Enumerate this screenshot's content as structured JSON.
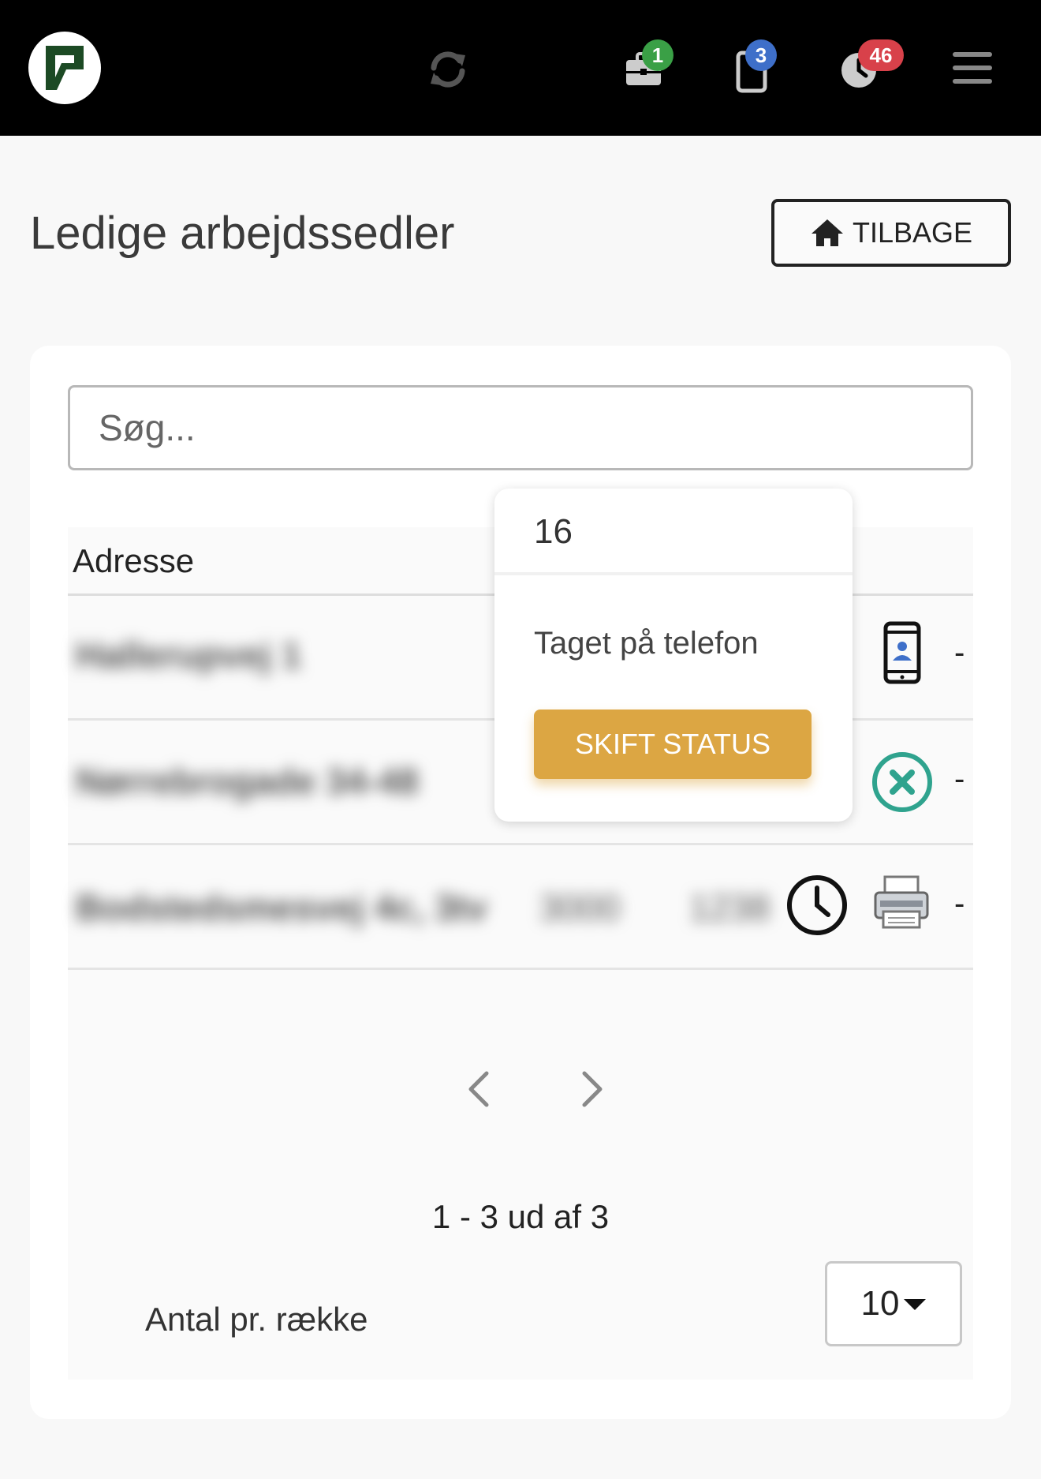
{
  "navbar": {
    "badges": {
      "briefcase": "1",
      "phone": "3",
      "clock": "46"
    },
    "colors": {
      "green": "#3aa046",
      "blue": "#3e6fc9",
      "red": "#d8414a"
    }
  },
  "header": {
    "title": "Ledige arbejdssedler",
    "back_label": "TILBAGE"
  },
  "search": {
    "placeholder": "Søg..."
  },
  "table": {
    "column_header": "Adresse",
    "rows": [
      {
        "address": "Hallerupvej 1",
        "dash": "-"
      },
      {
        "address": "Nørrebrogade 34-48",
        "dash": "-"
      },
      {
        "address": "Bodstedsmesvej 4c, 3tv",
        "col2": "3000",
        "col3": "1238",
        "dash": "-"
      }
    ]
  },
  "popover": {
    "title": "16",
    "body": "Taget på telefon",
    "button_label": "SKIFT STATUS"
  },
  "pagination": {
    "range_text": "1 - 3 ud af 3",
    "rows_label": "Antal pr. række",
    "rows_per_page": "10"
  }
}
